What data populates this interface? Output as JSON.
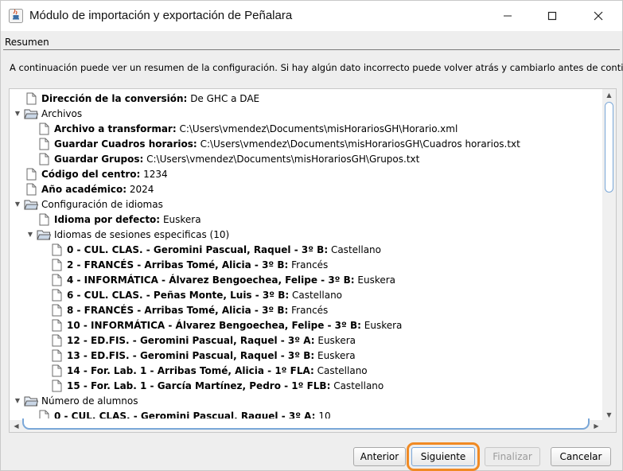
{
  "window": {
    "title": "Módulo de importación y exportación de Peñalara"
  },
  "section": {
    "label": "Resumen"
  },
  "description": "A continuación puede ver un resumen de la configuración. Si hay algún dato incorrecto puede volver atrás y cambiarlo antes de continuar.",
  "tree": [
    {
      "level": 0,
      "type": "leaf",
      "key": "Dirección de la conversión:",
      "value": "De GHC a DAE"
    },
    {
      "level": 0,
      "type": "folder",
      "key": "",
      "value": "Archivos"
    },
    {
      "level": 1,
      "type": "leaf",
      "key": "Archivo a transformar:",
      "value": "C:\\Users\\vmendez\\Documents\\misHorariosGH\\Horario.xml"
    },
    {
      "level": 1,
      "type": "leaf",
      "key": "Guardar Cuadros horarios:",
      "value": "C:\\Users\\vmendez\\Documents\\misHorariosGH\\Cuadros horarios.txt"
    },
    {
      "level": 1,
      "type": "leaf",
      "key": "Guardar Grupos:",
      "value": "C:\\Users\\vmendez\\Documents\\misHorariosGH\\Grupos.txt"
    },
    {
      "level": 0,
      "type": "leaf",
      "key": "Código del centro:",
      "value": "1234"
    },
    {
      "level": 0,
      "type": "leaf",
      "key": "Año académico:",
      "value": "2024"
    },
    {
      "level": 0,
      "type": "folder",
      "key": "",
      "value": "Configuración de idiomas"
    },
    {
      "level": 1,
      "type": "leaf",
      "key": "Idioma por defecto:",
      "value": "Euskera"
    },
    {
      "level": 1,
      "type": "folder",
      "key": "",
      "value": "Idiomas de sesiones especificas (10)"
    },
    {
      "level": 2,
      "type": "leaf",
      "key": "0 - CUL. CLAS. - Geromini Pascual, Raquel - 3º B:",
      "value": "Castellano"
    },
    {
      "level": 2,
      "type": "leaf",
      "key": "2 - FRANCÉS - Arribas Tomé, Alicia - 3º B:",
      "value": "Francés"
    },
    {
      "level": 2,
      "type": "leaf",
      "key": "4 - INFORMÁTICA - Álvarez Bengoechea, Felipe - 3º B:",
      "value": "Euskera"
    },
    {
      "level": 2,
      "type": "leaf",
      "key": "6 - CUL. CLAS. - Peñas Monte, Luis - 3º B:",
      "value": "Castellano"
    },
    {
      "level": 2,
      "type": "leaf",
      "key": "8 - FRANCÉS - Arribas Tomé, Alicia - 3º B:",
      "value": "Francés"
    },
    {
      "level": 2,
      "type": "leaf",
      "key": "10 - INFORMÁTICA - Álvarez Bengoechea, Felipe - 3º B:",
      "value": "Euskera"
    },
    {
      "level": 2,
      "type": "leaf",
      "key": "12 - ED.FIS. - Geromini Pascual, Raquel - 3º A:",
      "value": "Euskera"
    },
    {
      "level": 2,
      "type": "leaf",
      "key": "13 - ED.FIS. - Geromini Pascual, Raquel - 3º B:",
      "value": "Euskera"
    },
    {
      "level": 2,
      "type": "leaf",
      "key": "14 - For. Lab. 1 - Arribas Tomé, Alicia - 1º FLA:",
      "value": "Castellano"
    },
    {
      "level": 2,
      "type": "leaf",
      "key": "15 - For. Lab. 1 - García Martínez, Pedro - 1º FLB:",
      "value": "Castellano"
    },
    {
      "level": 0,
      "type": "folder",
      "key": "",
      "value": "Número de alumnos"
    },
    {
      "level": 1,
      "type": "leaf",
      "key": "0 - CUL. CLAS. - Geromini Pascual, Raquel - 3º A:",
      "value": "10"
    }
  ],
  "buttons": {
    "previous": "Anterior",
    "next": "Siguiente",
    "finish": "Finalizar",
    "cancel": "Cancelar"
  },
  "colors": {
    "focus_highlight": "#f08a24",
    "scroll_thumb_border": "#7aa7d8"
  }
}
